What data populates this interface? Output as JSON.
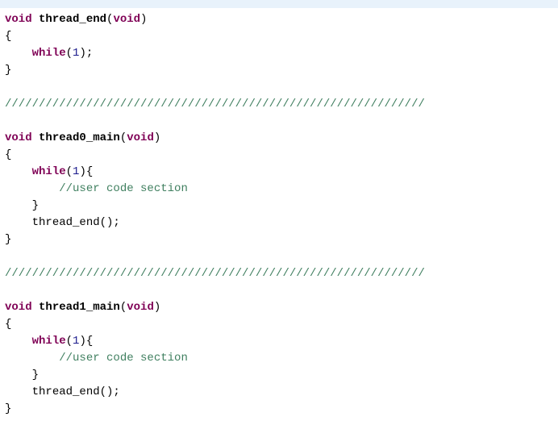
{
  "kw_void": "void",
  "kw_while": "while",
  "fn_thread_end": "thread_end",
  "fn_thread0_main": "thread0_main",
  "fn_thread1_main": "thread1_main",
  "open_paren": "(",
  "close_paren": ")",
  "open_brace": "{",
  "close_brace": "}",
  "close_brace_nl": "}",
  "num_1": "1",
  "semi": ";",
  "call_thread_end": "thread_end();",
  "comment_user": "//user code section",
  "divider1": "//////////////////////////////////////////////////////////////",
  "divider2": "//////////////////////////////////////////////////////////////",
  "indent1": "    ",
  "indent2": "        "
}
